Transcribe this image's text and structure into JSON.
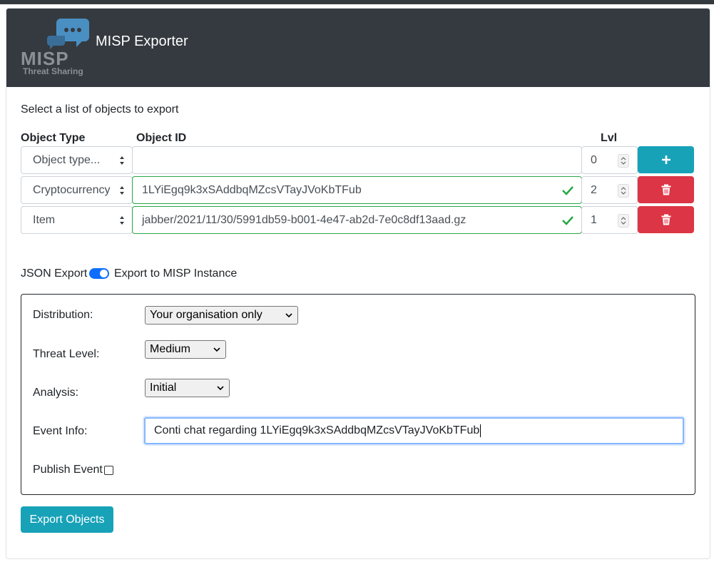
{
  "header": {
    "logo_text": "MISP",
    "logo_subtext": "Threat Sharing",
    "title": "MISP Exporter"
  },
  "objects": {
    "lead": "Select a list of objects to export",
    "col_type": "Object Type",
    "col_id": "Object ID",
    "col_lvl": "Lvl",
    "rows": [
      {
        "type": "Object type...",
        "id": "",
        "lvl": "0",
        "action": "add",
        "valid": false
      },
      {
        "type": "Cryptocurrency",
        "id": "1LYiEgq9k3xSAddbqMZcsVTayJVoKbTFub",
        "lvl": "2",
        "action": "delete",
        "valid": true
      },
      {
        "type": "Item",
        "id": "jabber/2021/11/30/5991db59-b001-4e47-ab2d-7e0c8df13aad.gz",
        "lvl": "1",
        "action": "delete",
        "valid": true
      }
    ]
  },
  "export_mode": {
    "left_label": "JSON Export",
    "right_label": "Export to MISP Instance",
    "enabled": true
  },
  "misp_form": {
    "distribution_label": "Distribution:",
    "distribution_value": "Your organisation only",
    "threat_level_label": "Threat Level:",
    "threat_level_value": "Medium",
    "analysis_label": "Analysis:",
    "analysis_value": "Initial",
    "event_info_label": "Event Info:",
    "event_info_value": "Conti chat regarding 1LYiEgq9k3xSAddbqMZcsVTayJVoKbTFub",
    "publish_label": "Publish Event",
    "publish_checked": false
  },
  "export_button": "Export Objects",
  "colors": {
    "header_bg": "#343a40",
    "info": "#17a2b8",
    "danger": "#dc3545",
    "success": "#28a745",
    "toggle": "#0d6efd"
  }
}
